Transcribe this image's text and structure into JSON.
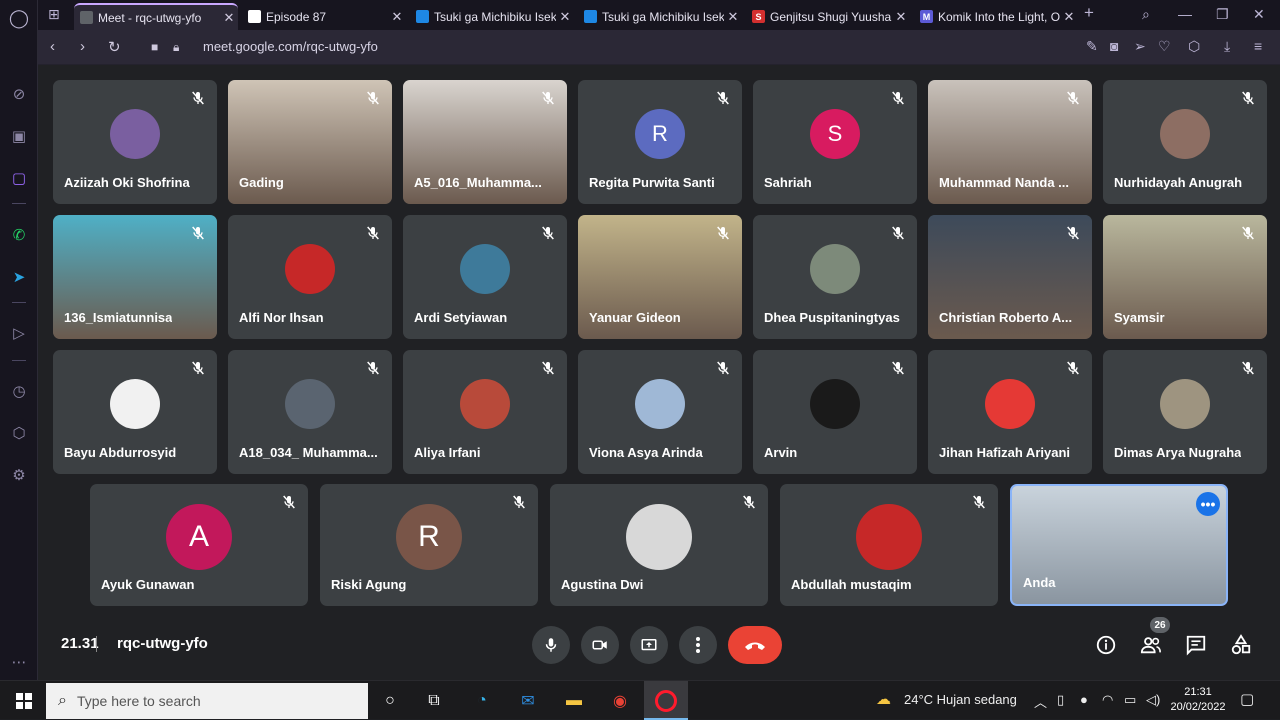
{
  "browser": {
    "tabs": [
      {
        "title": "Meet - rqc-utwg-yfo",
        "color": "#5f6368",
        "glyph": "",
        "active": true
      },
      {
        "title": "Episode 87",
        "color": "#ffffff",
        "glyph": "",
        "active": false
      },
      {
        "title": "Tsuki ga Michibiku Isek",
        "color": "#1e88e5",
        "glyph": "",
        "active": false
      },
      {
        "title": "Tsuki ga Michibiku Isek",
        "color": "#1e88e5",
        "glyph": "",
        "active": false
      },
      {
        "title": "Genjitsu Shugi Yuusha",
        "color": "#d32f2f",
        "glyph": "S",
        "active": false
      },
      {
        "title": "Komik Into the Light, O",
        "color": "#5c5ad6",
        "glyph": "M",
        "active": false
      }
    ],
    "new_tab": "+",
    "url": "meet.google.com/rqc-utwg-yfo"
  },
  "meet": {
    "time": "21.31",
    "meeting_code": "rqc-utwg-yfo",
    "participant_count": "26",
    "tiles": [
      {
        "name": "Aziizah Oki Shofrina",
        "type": "avatar",
        "bg": "#7a5fa0",
        "letter": ""
      },
      {
        "name": "Gading",
        "type": "photo",
        "bg": "#cfc4b6",
        "letter": ""
      },
      {
        "name": "A5_016_Muhamma...",
        "type": "photo",
        "bg": "#d9d4cf",
        "letter": ""
      },
      {
        "name": "Regita Purwita Santi",
        "type": "avatar",
        "bg": "#5c6bc0",
        "letter": "R"
      },
      {
        "name": "Sahriah",
        "type": "avatar",
        "bg": "#d81b60",
        "letter": "S"
      },
      {
        "name": "Muhammad Nanda ...",
        "type": "photo",
        "bg": "#c9c2bb",
        "letter": ""
      },
      {
        "name": "Nurhidayah Anugrah",
        "type": "avatar",
        "bg": "#8d6e63",
        "letter": ""
      },
      {
        "name": "136_Ismiatunnisa",
        "type": "photo",
        "bg": "#4fb0c6",
        "letter": ""
      },
      {
        "name": "Alfi Nor Ihsan",
        "type": "avatar",
        "bg": "#c62828",
        "letter": ""
      },
      {
        "name": "Ardi Setyiawan",
        "type": "avatar",
        "bg": "#3e7a9a",
        "letter": ""
      },
      {
        "name": "Yanuar Gideon",
        "type": "photo",
        "bg": "#c2b48a",
        "letter": ""
      },
      {
        "name": "Dhea Puspitaningtyas",
        "type": "avatar",
        "bg": "#7d8a7a",
        "letter": ""
      },
      {
        "name": "Christian Roberto A...",
        "type": "photo",
        "bg": "#3d4a5a",
        "letter": ""
      },
      {
        "name": "Syamsir",
        "type": "photo",
        "bg": "#b9b79d",
        "letter": ""
      },
      {
        "name": "Bayu Abdurrosyid",
        "type": "avatar",
        "bg": "#f1f1f1",
        "letter": ""
      },
      {
        "name": "A18_034_ Muhamma...",
        "type": "avatar",
        "bg": "#5a6470",
        "letter": ""
      },
      {
        "name": "Aliya Irfani",
        "type": "avatar",
        "bg": "#b84a3a",
        "letter": ""
      },
      {
        "name": "Viona Asya Arinda",
        "type": "avatar",
        "bg": "#9fb8d6",
        "letter": ""
      },
      {
        "name": "Arvin",
        "type": "avatar",
        "bg": "#1a1a1a",
        "letter": ""
      },
      {
        "name": "Jihan Hafizah Ariyani",
        "type": "avatar",
        "bg": "#e53935",
        "letter": ""
      },
      {
        "name": "Dimas Arya Nugraha",
        "type": "avatar",
        "bg": "#9e9480",
        "letter": ""
      },
      {
        "name": "Ayuk Gunawan",
        "type": "avatar",
        "bg": "#c2185b",
        "letter": "A"
      },
      {
        "name": "Riski Agung",
        "type": "avatar",
        "bg": "#795548",
        "letter": "R"
      },
      {
        "name": "Agustina Dwi",
        "type": "avatar",
        "bg": "#d8d8d8",
        "letter": ""
      },
      {
        "name": "Abdullah mustaqim",
        "type": "avatar",
        "bg": "#c62828",
        "letter": ""
      },
      {
        "name": "Anda",
        "type": "self",
        "bg": "#9aa7b3",
        "letter": ""
      }
    ]
  },
  "taskbar": {
    "search_placeholder": "Type here to search",
    "weather": "24°C  Hujan sedang",
    "clock_time": "21:31",
    "clock_date": "20/02/2022"
  },
  "colors": {
    "accent": "#c9a8ff",
    "end_call": "#ea4335",
    "tile": "#3c4043",
    "self_border": "#8ab4f8"
  }
}
